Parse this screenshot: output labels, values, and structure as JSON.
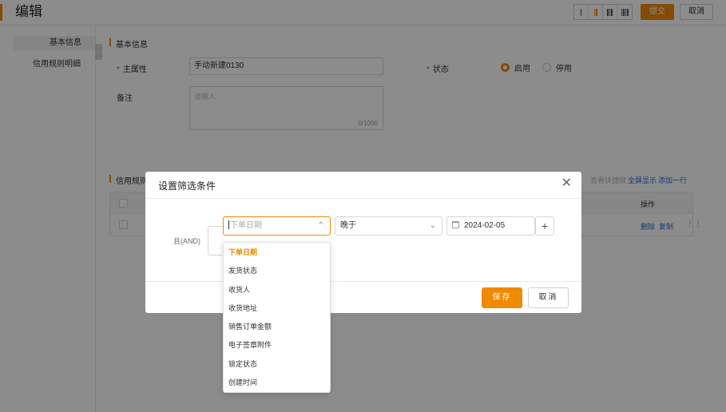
{
  "header": {
    "title": "编辑",
    "layout_options": [
      "I",
      "II",
      "III",
      "IIII"
    ],
    "submit_label": "提交",
    "cancel_label": "取消"
  },
  "sidebar": {
    "items": [
      {
        "label": "基本信息",
        "active": true
      },
      {
        "label": "信用规则明细",
        "active": false
      }
    ]
  },
  "basic_info": {
    "section_title": "基本信息",
    "main_attr_label": "主属性",
    "main_attr_value": "手动新建0130",
    "status_label": "状态",
    "status_options": [
      {
        "label": "启用",
        "checked": true
      },
      {
        "label": "停用",
        "checked": false
      }
    ],
    "remark_label": "备注",
    "remark_placeholder": "请输入",
    "remark_count": "0/1000"
  },
  "credit_rules": {
    "section_title": "信用规则",
    "toolbar": {
      "shortcuts_label": "查看快捷键",
      "fullscreen_label": "全屏显示",
      "add_row_label": "添加一行"
    },
    "ops_header": "操作",
    "row_actions": {
      "delete": "删除",
      "copy": "复制"
    }
  },
  "modal": {
    "title": "设置筛选条件",
    "logic_label": "且(AND)",
    "field_placeholder": "下单日期",
    "operator_value": "晚于",
    "date_value": "2024-02-05",
    "add_label": "+",
    "save_label": "保存",
    "cancel_label": "取消"
  },
  "dropdown": {
    "options": [
      {
        "label": "下单日期",
        "selected": true
      },
      {
        "label": "发货状态",
        "selected": false
      },
      {
        "label": "收货人",
        "selected": false
      },
      {
        "label": "收货地址",
        "selected": false
      },
      {
        "label": "销售订单金额",
        "selected": false
      },
      {
        "label": "电子签章附件",
        "selected": false
      },
      {
        "label": "锁定状态",
        "selected": false
      },
      {
        "label": "创建时间",
        "selected": false
      }
    ]
  },
  "colors": {
    "accent": "#f08a00",
    "link": "#2a6bd8",
    "required": "#e54b4b"
  }
}
